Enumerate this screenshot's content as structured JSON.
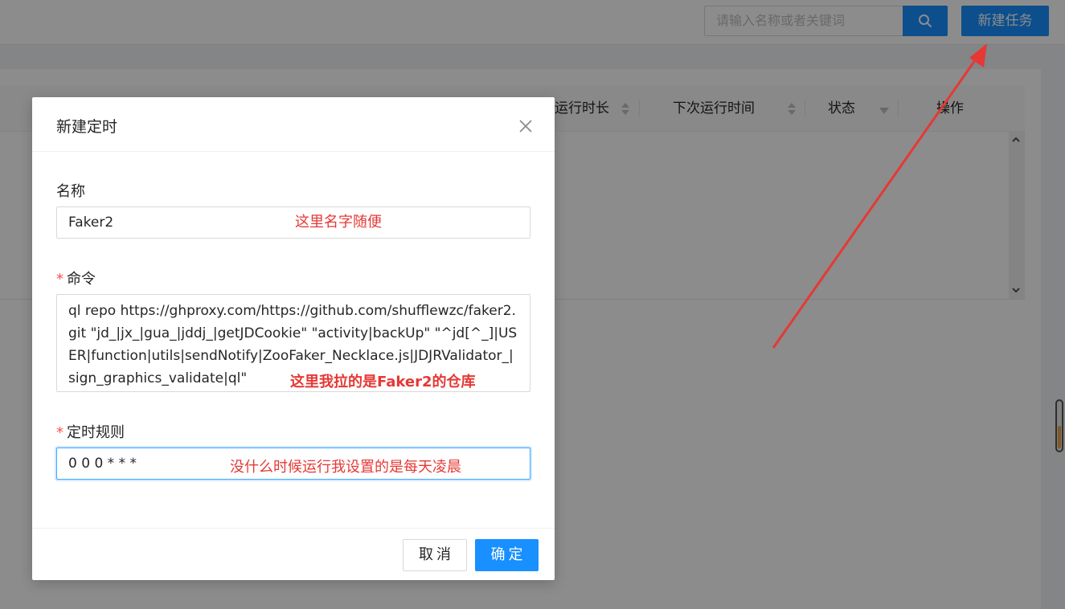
{
  "topbar": {
    "search_placeholder": "请输入名称或者关键词",
    "new_task_label": "新建任务"
  },
  "table": {
    "columns": [
      "运行时长",
      "下次运行时间",
      "状态",
      "操作"
    ]
  },
  "modal": {
    "title": "新建定时",
    "name_label": "名称",
    "name_value": "Faker2",
    "command_label": "命令",
    "command_value": "ql repo https://ghproxy.com/https://github.com/shufflewzc/faker2.git \"jd_|jx_|gua_|jddj_|getJDCookie\" \"activity|backUp\" \"^jd[^_]|USER|function|utils|sendNotify|ZooFaker_Necklace.js|JDJRValidator_|sign_graphics_validate|ql\"",
    "cron_label": "定时规则",
    "cron_value": "0 0 0 * * *",
    "required_mark": "*",
    "cancel_label": "取消",
    "ok_label": "确定"
  },
  "annotations": {
    "name_note": "这里名字随便",
    "command_note": "这里我拉的是Faker2的仓库",
    "cron_note": "没什么时候运行我设置的是每天凌晨",
    "color": "#e53935"
  },
  "colors": {
    "primary": "#1890ff",
    "required": "#ff4d4f"
  }
}
